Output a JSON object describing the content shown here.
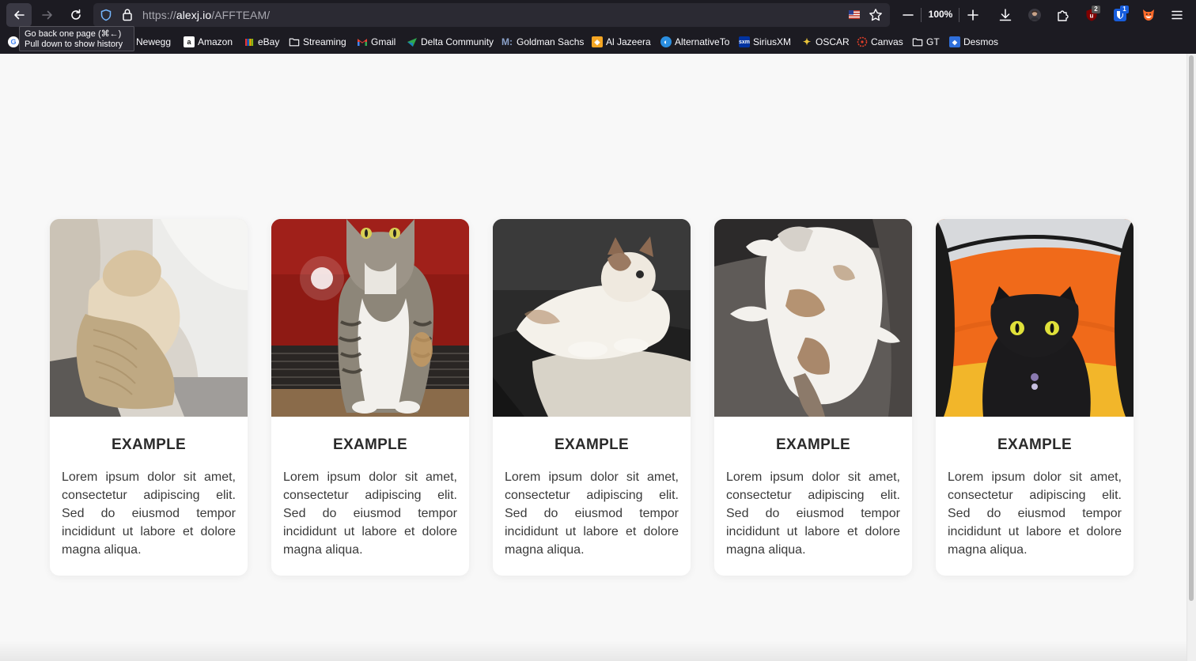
{
  "browser": {
    "url_scheme": "https://",
    "url_domain": "alexj.io",
    "url_path": "/AFFTEAM/",
    "zoom": "100%",
    "badges": {
      "extension_red": "2",
      "extension_blue": "1"
    },
    "tooltip": {
      "line1": "Go back one page (⌘←)",
      "line2": "Pull down to show history"
    },
    "accent_color": "#1c1b22"
  },
  "bookmarks": [
    {
      "label": "Newegg",
      "icon": "newegg-icon"
    },
    {
      "label": "Amazon",
      "icon": "amazon-icon"
    },
    {
      "label": "eBay",
      "icon": "ebay-icon"
    },
    {
      "label": "Streaming",
      "icon": "folder-icon"
    },
    {
      "label": "Gmail",
      "icon": "gmail-icon"
    },
    {
      "label": "Delta Community",
      "icon": "delta-icon"
    },
    {
      "label": "Goldman Sachs",
      "icon": "goldman-sachs-icon"
    },
    {
      "label": "Al Jazeera",
      "icon": "al-jazeera-icon"
    },
    {
      "label": "AlternativeTo",
      "icon": "alternativeto-icon"
    },
    {
      "label": "SiriusXM",
      "icon": "siriusxm-icon"
    },
    {
      "label": "OSCAR",
      "icon": "oscar-icon"
    },
    {
      "label": "Canvas",
      "icon": "canvas-icon"
    },
    {
      "label": "GT",
      "icon": "folder-icon"
    },
    {
      "label": "Desmos",
      "icon": "desmos-icon"
    }
  ],
  "cards": [
    {
      "title": "EXAMPLE",
      "body": "Lorem ipsum dolor sit amet, consectetur adipiscing elit. Sed do eiusmod tempor incididunt ut labore et dolore magna aliqua."
    },
    {
      "title": "EXAMPLE",
      "body": "Lorem ipsum dolor sit amet, consectetur adipiscing elit. Sed do eiusmod tempor incididunt ut labore et dolore magna aliqua."
    },
    {
      "title": "EXAMPLE",
      "body": "Lorem ipsum dolor sit amet, consectetur adipiscing elit. Sed do eiusmod tempor incididunt ut labore et dolore magna aliqua."
    },
    {
      "title": "EXAMPLE",
      "body": "Lorem ipsum dolor sit amet, consectetur adipiscing elit. Sed do eiusmod tempor incididunt ut labore et dolore magna aliqua."
    },
    {
      "title": "EXAMPLE",
      "body": "Lorem ipsum dolor sit amet, consectetur adipiscing elit. Sed do eiusmod tempor incididunt ut labore et dolore magna aliqua."
    }
  ]
}
